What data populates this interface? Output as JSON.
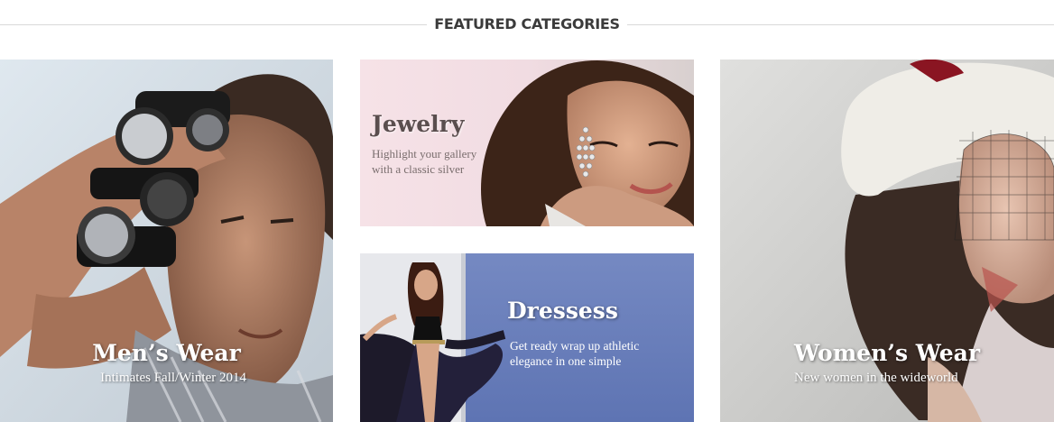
{
  "section": {
    "title": "FEATURED CATEGORIES"
  },
  "categories": [
    {
      "title": "Men’s Wear",
      "subtitle": "Intimates Fall/Winter 2014"
    },
    {
      "title": "Jewelry",
      "subtitle": "Highlight your gallery with a classic silver"
    },
    {
      "title": "Dressess",
      "subtitle": "Get ready wrap up athletic elegance in one simple"
    },
    {
      "title": "Women’s Wear",
      "subtitle": "New women in the wideworld"
    }
  ],
  "colors": {
    "header_text": "#3b3b3b",
    "header_line": "#d9d9d9",
    "jewelry_bg": "#f3dde4",
    "dresses_sky": "#6d82bd",
    "womens_bg": "#d6d6d4",
    "mens_bg": "#dbe3ea"
  }
}
